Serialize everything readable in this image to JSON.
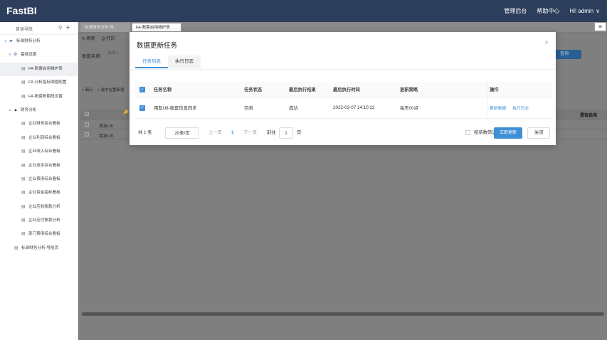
{
  "header": {
    "logo": "FastBI",
    "nav": [
      "管理后台",
      "帮助中心"
    ],
    "user_greeting": "Hi! admin",
    "user_caret": "∨"
  },
  "sidebar": {
    "title": "目录导航",
    "items": [
      {
        "label": "标准财务分析",
        "level": 0,
        "arrow": "∨",
        "icon": "folder-icon"
      },
      {
        "label": "基础设置",
        "level": 1,
        "arrow": "∨",
        "icon": "gear-icon"
      },
      {
        "label": "FA-账套启用维护表",
        "level": 2,
        "active": true,
        "icon": "report-icon"
      },
      {
        "label": "FA-分析指标阈值配置",
        "level": 2,
        "icon": "report-icon"
      },
      {
        "label": "FA-账套账期段设置",
        "level": 2,
        "icon": "report-icon"
      },
      {
        "label": "财务分析",
        "level": 1,
        "arrow": "∨",
        "icon": "chart-icon"
      },
      {
        "label": "企业财务综合看板",
        "level": 2,
        "icon": "report-icon"
      },
      {
        "label": "企业利润综合看板",
        "level": 2,
        "icon": "report-icon"
      },
      {
        "label": "企业收入综合看板",
        "level": 2,
        "icon": "report-icon"
      },
      {
        "label": "企业成本综合看板",
        "level": 2,
        "icon": "report-icon"
      },
      {
        "label": "企业费用综合看板",
        "level": 2,
        "icon": "report-icon"
      },
      {
        "label": "企业资金指标看板",
        "level": 2,
        "icon": "report-icon"
      },
      {
        "label": "企业应收账款分析",
        "level": 2,
        "icon": "report-icon"
      },
      {
        "label": "企业应付账款分析",
        "level": 2,
        "icon": "report-icon"
      },
      {
        "label": "部门费用综合看板",
        "level": 2,
        "icon": "report-icon"
      },
      {
        "label": "标准财务分析-导航页",
        "level": 1,
        "icon": "report-icon"
      }
    ]
  },
  "tabs": [
    "标准财务分析-导...",
    "FA-账套启用维护表"
  ],
  "background_page": {
    "toolbar": [
      "刷新",
      "打印"
    ],
    "query_label": "账套名称:",
    "query_placeholder": "请输入",
    "query_button": "查询",
    "toolbar2": [
      "+ 新行",
      "+ 选中位置新增"
    ],
    "grid_header_end": "是否启用",
    "rows": [
      "用友U8",
      "用友U8"
    ]
  },
  "modal": {
    "title": "数据更新任务",
    "close": "×",
    "tabs": [
      "任务列表",
      "执行日志"
    ],
    "columns": [
      "任务名称",
      "任务状态",
      "最后执行结果",
      "最后执行时间",
      "更新策略",
      "操作"
    ],
    "rows": [
      {
        "name": "用友U8-账套信息同步",
        "status": "空闲",
        "result": "成功",
        "time": "2022-03-07 14:10:22",
        "strategy": "每天00点",
        "actions": [
          "更新数据",
          "执行日志"
        ]
      }
    ],
    "footer": {
      "total": "共 1 条",
      "page_size": "20条/页",
      "prev": "上一页",
      "current": "1",
      "next": "下一页",
      "goto_label": "前往",
      "goto_value": "1",
      "page_unit": "页",
      "filter_label": "按参数筛选",
      "update_now": "立即更新",
      "close": "关闭"
    }
  },
  "colors": {
    "header_bg": "#2c3e5c",
    "accent": "#3e8fd6",
    "overlay": "#7f7f7f"
  }
}
